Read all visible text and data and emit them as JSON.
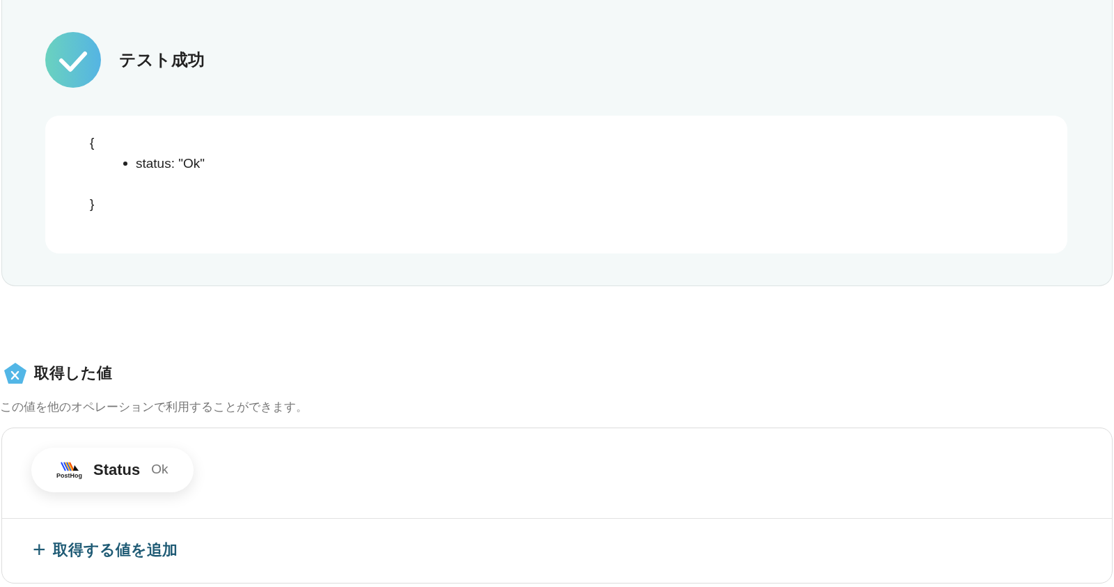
{
  "result": {
    "title": "テスト成功",
    "open_brace": "{",
    "items": [
      "status: \"Ok\""
    ],
    "close_brace": "}"
  },
  "values_section": {
    "title": "取得した値",
    "description": "この値を他のオペレーションで利用することができます。",
    "values": [
      {
        "logo_caption": "PostHog",
        "name": "Status",
        "value": "Ok"
      }
    ],
    "add_button": {
      "icon": "+",
      "label": "取得する値を追加"
    }
  }
}
